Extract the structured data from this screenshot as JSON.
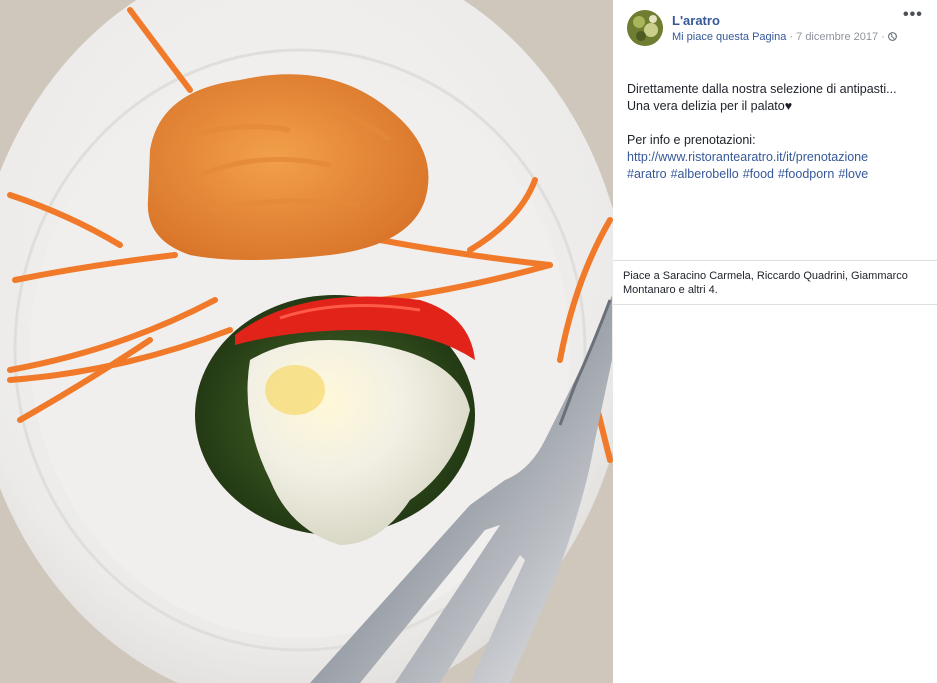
{
  "post": {
    "page_name": "L'aratro",
    "like_page": "Mi piace questa Pagina",
    "separator": " · ",
    "date": "7 dicembre 2017",
    "separator2": " · ",
    "text_line1": "Direttamente dalla nostra selezione di antipasti...",
    "text_line2": "Una vera delizia per il palato♥",
    "text_line3": "Per info e prenotazioni:",
    "link": "http://www.ristorantearatro.it/it/prenotazione",
    "hashtags": [
      "#aratro",
      "#alberobello",
      "#food",
      "#foodporn",
      "#love"
    ],
    "likes_summary": "Piace a Saracino Carmela, Riccardo Quadrini, Giammarco Montanaro e altri 4."
  },
  "icons": {
    "more": "more-options-icon",
    "globe": "globe-icon"
  },
  "colors": {
    "link": "#365899",
    "meta": "#90949c",
    "text": "#1d2129"
  }
}
